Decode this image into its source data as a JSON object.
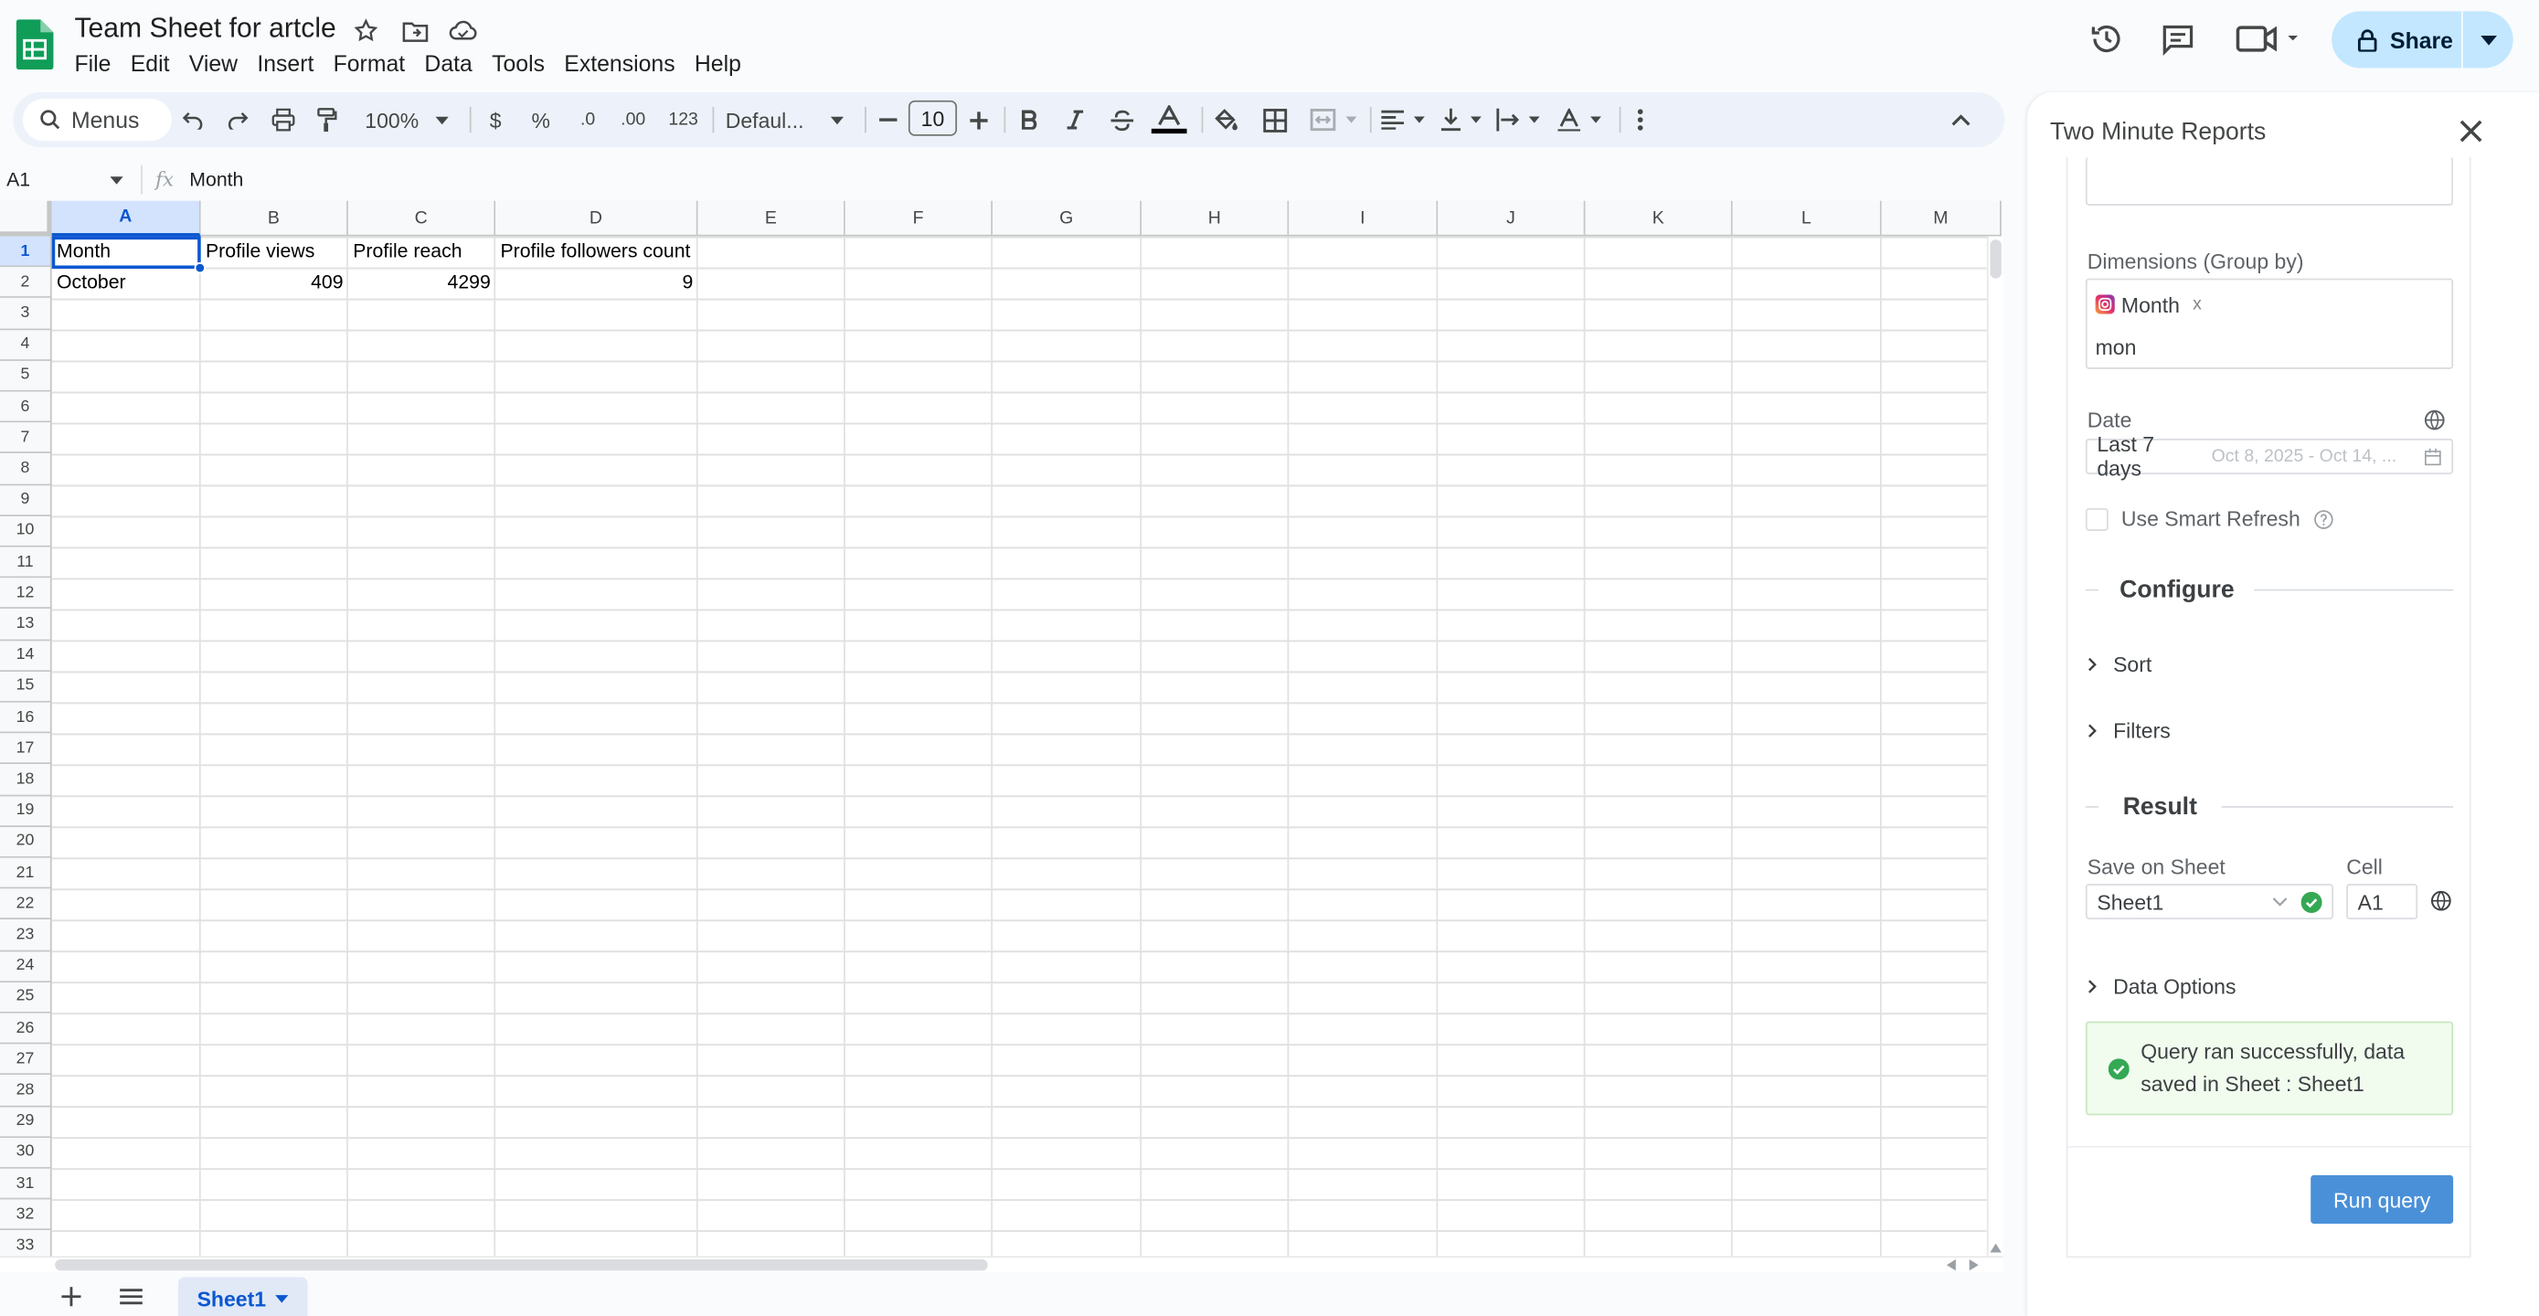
{
  "doc": {
    "title": "Team Sheet for artcle",
    "menu": [
      "File",
      "Edit",
      "View",
      "Insert",
      "Format",
      "Data",
      "Tools",
      "Extensions",
      "Help"
    ]
  },
  "header": {
    "share_label": "Share"
  },
  "toolbar": {
    "menus_label": "Menus",
    "zoom": "100%",
    "currency": "$",
    "percent": "%",
    "dec_dec": ".0",
    "inc_dec": ".00",
    "number_format": "123",
    "font": "Defaul...",
    "font_size": "10"
  },
  "formula_bar": {
    "cell_ref": "A1",
    "fx": "fx",
    "content": "Month"
  },
  "grid": {
    "columns": [
      "A",
      "B",
      "C",
      "D",
      "E",
      "F",
      "G",
      "H",
      "I",
      "J",
      "K",
      "L",
      "M"
    ],
    "rows": [
      "1",
      "2",
      "3",
      "4",
      "5",
      "6",
      "7",
      "8",
      "9",
      "10",
      "11",
      "12",
      "13",
      "14",
      "15",
      "16",
      "17",
      "18",
      "19",
      "20",
      "21",
      "22",
      "23",
      "24",
      "25",
      "26",
      "27",
      "28",
      "29",
      "30",
      "31",
      "32",
      "33"
    ],
    "data": [
      [
        "Month",
        "Profile views",
        "Profile reach",
        "Profile followers count"
      ],
      [
        "October",
        "409",
        "4299",
        "9"
      ]
    ]
  },
  "sheets": {
    "active": "Sheet1"
  },
  "panel": {
    "title": "Two Minute Reports",
    "dimensions_label": "Dimensions (Group by)",
    "dimension_chip": "Month",
    "dimension_chip_remove": "x",
    "dimension_input": "mon",
    "date_label": "Date",
    "date_value": "Last 7 days",
    "date_range": "Oct 8, 2025 - Oct 14, ...",
    "smart_refresh_label": "Use Smart Refresh",
    "configure_heading": "Configure",
    "sort_label": "Sort",
    "filters_label": "Filters",
    "result_heading": "Result",
    "save_on_sheet_label": "Save on Sheet",
    "save_on_sheet_value": "Sheet1",
    "cell_label": "Cell",
    "cell_value": "A1",
    "data_options_label": "Data Options",
    "success_message": "Query ran successfully, data saved in Sheet : Sheet1",
    "run_button": "Run query"
  },
  "colors": {
    "accent": "#0b57d0",
    "share_bg": "#c2e7ff",
    "success_green": "#34a853",
    "run_btn": "#4a90d9"
  }
}
